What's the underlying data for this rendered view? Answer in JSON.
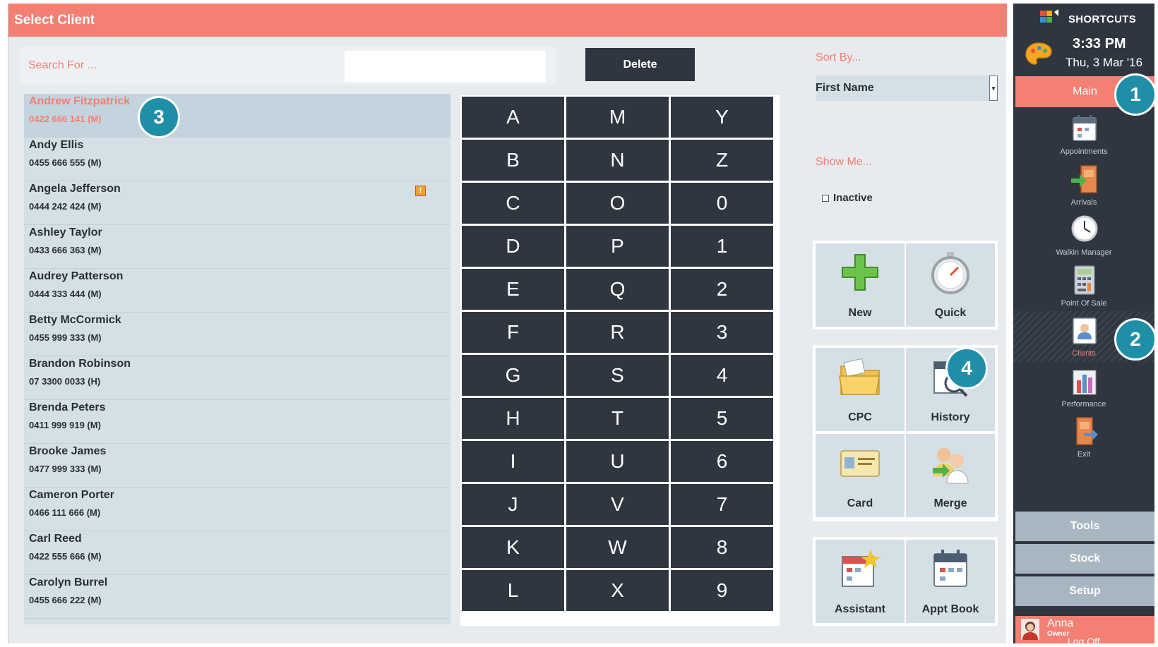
{
  "window": {
    "title": "Select Client"
  },
  "search": {
    "label": "Search For ...",
    "value": ""
  },
  "delete_label": "Delete",
  "clients": [
    {
      "name": "Andrew  Fitzpatrick",
      "phone": "0422 666 141 (M)",
      "selected": true
    },
    {
      "name": "Andy  Ellis",
      "phone": "0455 666 555 (M)"
    },
    {
      "name": "Angela  Jefferson",
      "phone": "0444 242 424 (M)",
      "alert": "!"
    },
    {
      "name": "Ashley  Taylor",
      "phone": "0433 666 363 (M)"
    },
    {
      "name": "Audrey  Patterson",
      "phone": "0444 333 444 (M)"
    },
    {
      "name": "Betty  McCormick",
      "phone": "0455 999 333 (M)"
    },
    {
      "name": "Brandon  Robinson",
      "phone": " 07 3300 0033 (H)"
    },
    {
      "name": "Brenda  Peters",
      "phone": "0411 999 919 (M)"
    },
    {
      "name": "Brooke  James",
      "phone": "0477 999 333 (M)"
    },
    {
      "name": "Cameron  Porter",
      "phone": "0466 111 666 (M)"
    },
    {
      "name": "Carl  Reed",
      "phone": "0422 555 666 (M)"
    },
    {
      "name": "Carolyn  Burrel",
      "phone": "0455 666 222 (M)"
    }
  ],
  "letters": [
    [
      "A",
      "M",
      "Y"
    ],
    [
      "B",
      "N",
      "Z"
    ],
    [
      "C",
      "O",
      "0"
    ],
    [
      "D",
      "P",
      "1"
    ],
    [
      "E",
      "Q",
      "2"
    ],
    [
      "F",
      "R",
      "3"
    ],
    [
      "G",
      "S",
      "4"
    ],
    [
      "H",
      "T",
      "5"
    ],
    [
      "I",
      "U",
      "6"
    ],
    [
      "J",
      "V",
      "7"
    ],
    [
      "K",
      "W",
      "8"
    ],
    [
      "L",
      "X",
      "9"
    ]
  ],
  "sort": {
    "label": "Sort By...",
    "value": "First Name"
  },
  "show": {
    "label": "Show Me...",
    "inactive_label": "Inactive",
    "inactive_checked": false
  },
  "actions": {
    "new": "New",
    "quick": "Quick",
    "cpc": "CPC",
    "history": "History",
    "card": "Card",
    "merge": "Merge",
    "assistant": "Assistant",
    "appt_book": "Appt Book"
  },
  "sidebar": {
    "shortcuts": "SHORTCUTS",
    "time": "3:33 PM",
    "date": "Thu, 3 Mar '16",
    "main_tab": "Main",
    "items": [
      {
        "label": "Appointments",
        "icon": "calendar-icon"
      },
      {
        "label": "Arrivals",
        "icon": "arrivals-door-icon"
      },
      {
        "label": "Walkin Manager",
        "icon": "clock-icon"
      },
      {
        "label": "Point Of Sale",
        "icon": "calculator-icon"
      },
      {
        "label": "Clients",
        "icon": "client-card-icon",
        "active": true
      },
      {
        "label": "Performance",
        "icon": "bar-chart-icon"
      },
      {
        "label": "Exit",
        "icon": "exit-door-icon"
      }
    ],
    "tools": "Tools",
    "stock": "Stock",
    "setup": "Setup",
    "user": {
      "name": "Anna",
      "role": "Owner",
      "logoff": "Log Off"
    }
  },
  "callouts": [
    "1",
    "2",
    "3",
    "4"
  ],
  "colors": {
    "accent": "#f47f73",
    "dark": "#2f3640",
    "callout": "#1f8fa8",
    "list_bg": "#d4dfe6"
  }
}
